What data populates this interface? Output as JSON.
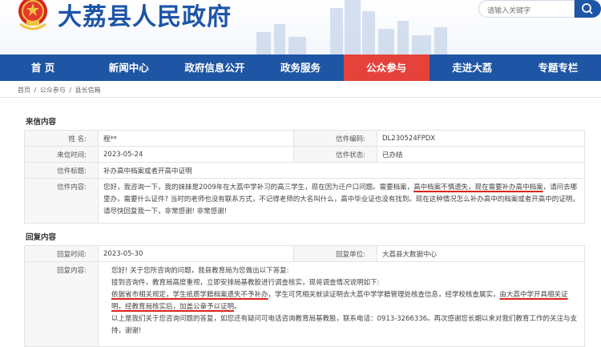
{
  "header": {
    "site_title": "大荔县人民政府",
    "search_placeholder": "请输入关键字"
  },
  "nav": {
    "items": [
      {
        "label": "首  页"
      },
      {
        "label": "新闻中心"
      },
      {
        "label": "政府信息公开"
      },
      {
        "label": "政务服务"
      },
      {
        "label": "公众参与"
      },
      {
        "label": "走进大荔"
      },
      {
        "label": "专题专栏"
      }
    ],
    "active_index": 4
  },
  "breadcrumb": {
    "items": [
      "首页",
      "公众参与",
      "县长信箱"
    ],
    "separator": "/"
  },
  "letter": {
    "section_title": "来信内容",
    "name_label": "姓    名:",
    "name_value": "程**",
    "code_label": "信件编码:",
    "code_value": "DL230524FPDX",
    "date_label": "来信时间:",
    "date_value": "2023-05-24",
    "status_label": "信件状态:",
    "status_value": "已办结",
    "subject_label": "信件标题:",
    "subject_value": "补办高中档案或者开高中证明",
    "content_label": "信件内容:",
    "content_part1": "您好，我咨询一下，我的妹妹是2009年在大荔中学补习的高三学生，现在因为迁户口问题。需要档案，",
    "content_underline": "高中档案不慎遗失，现在需要补办高中档案",
    "content_part2": "，请问去哪里办，需要什么证件? 当时的老师也没有联系方式，不记得老师的大名叫什么，高中毕业证也没有找到。现在这种情况怎么补办高中的档案或者开高中的证明，请尽快回复我一下，非常感谢! 非常感谢!"
  },
  "reply": {
    "section_title": "回复内容",
    "date_label": "回复时间:",
    "date_value": "2023-05-30",
    "unit_label": "回复单位:",
    "unit_value": "大荔县大数据中心",
    "content_label": "回复内容:",
    "line1": "您好! 关于您所咨询的问题，我县教育局为您做出以下答复:",
    "line2": "接到咨询件，教育局高度重视，立即安排局基教股进行调查核实，现将调查情况说明如下:",
    "line3_underline_a": "依据省市相关规定，学生纸质学籍档案遗失不予补办",
    "line3_mid": "，学生可凭相关就读证明去大荔中学学籍管理处核查信息，经学校核查属实，",
    "line3_underline_b": "由大荔中学开具相关证明，经教育局核实后，加盖公章予以证明",
    "line3_end": "。",
    "line4": "以上是我们关于您咨询问题的答复，如您还有疑问可电话咨询教育局基教股，联系电话：0913-3266336。再次感谢您长期以来对我们教育工作的关注与支持，谢谢!"
  },
  "colors": {
    "brand_blue": "#1d55a7",
    "nav_blue": "#1e55a4",
    "active_red": "#e5423b",
    "annotation_red": "#d9251c"
  }
}
